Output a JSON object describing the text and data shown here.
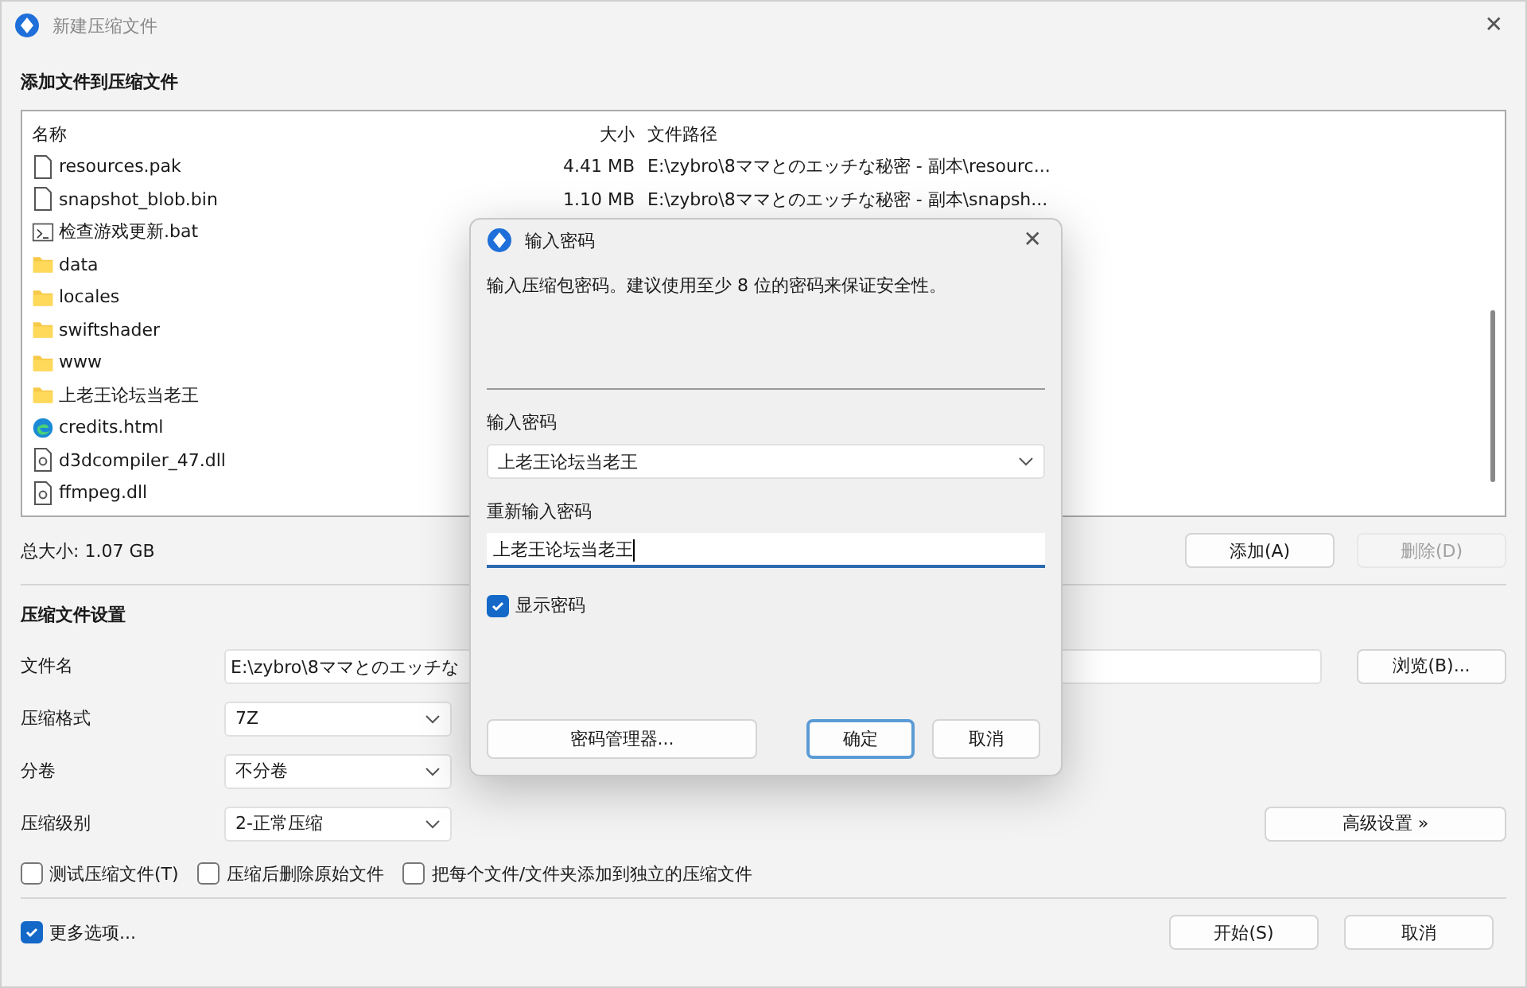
{
  "window": {
    "title": "新建压缩文件",
    "close": "✕"
  },
  "add_section": {
    "heading": "添加文件到压缩文件"
  },
  "file_list": {
    "columns": [
      "名称",
      "大小",
      "文件路径"
    ],
    "rows": [
      {
        "kind": "file",
        "name": "resources.pak",
        "size": "4.41 MB",
        "path": "E:\\zybro\\8ママとのエッチな秘密 - 副本\\resourc..."
      },
      {
        "kind": "file",
        "name": "snapshot_blob.bin",
        "size": "1.10 MB",
        "path": "E:\\zybro\\8ママとのエッチな秘密 - 副本\\snapsh..."
      },
      {
        "kind": "script",
        "name": "检查游戏更新.bat"
      },
      {
        "kind": "folder",
        "name": "data"
      },
      {
        "kind": "folder",
        "name": "locales"
      },
      {
        "kind": "folder",
        "name": "swiftshader"
      },
      {
        "kind": "folder",
        "name": "www"
      },
      {
        "kind": "folder",
        "name": "上老王论坛当老王"
      },
      {
        "kind": "web",
        "name": "credits.html"
      },
      {
        "kind": "dll",
        "name": "d3dcompiler_47.dll"
      },
      {
        "kind": "dll",
        "name": "ffmpeg.dll"
      }
    ]
  },
  "total_size": "总大小: 1.07 GB",
  "list_buttons": [
    {
      "label": "添加(A)",
      "disabled": false
    },
    {
      "label": "删除(D)",
      "disabled": true
    }
  ],
  "settings": {
    "heading": "压缩文件设置",
    "fields": [
      {
        "kind": "text",
        "label": "文件名",
        "value": "E:\\zybro\\8ママとのエッチな"
      },
      {
        "kind": "select",
        "label": "压缩格式",
        "value": "7Z"
      },
      {
        "kind": "select",
        "label": "分卷",
        "value": "不分卷"
      },
      {
        "kind": "select",
        "label": "压缩级别",
        "value": "2-正常压缩"
      }
    ],
    "browse_button": "浏览(B)...",
    "advanced_button": "高级设置 »",
    "options": [
      {
        "label": "测试压缩文件(T)",
        "checked": false
      },
      {
        "label": "压缩后删除原始文件",
        "checked": false
      },
      {
        "label": "把每个文件/文件夹添加到独立的压缩文件",
        "checked": false
      }
    ]
  },
  "more_options": {
    "label": "更多选项...",
    "checked": true
  },
  "footer_buttons": [
    "开始(S)",
    "取消"
  ],
  "password_dialog": {
    "title": "输入密码",
    "close": "✕",
    "hint": "输入压缩包密码。建议使用至少 8 位的密码来保证安全性。",
    "password_label": "输入密码",
    "password_value": "上老王论坛当老王",
    "confirm_label": "重新输入密码",
    "confirm_value": "上老王论坛当老王",
    "show_password": {
      "label": "显示密码",
      "checked": true
    },
    "buttons": [
      {
        "label": "密码管理器...",
        "focused": false
      },
      {
        "label": "确定",
        "focused": true
      },
      {
        "label": "取消",
        "focused": false
      }
    ]
  }
}
